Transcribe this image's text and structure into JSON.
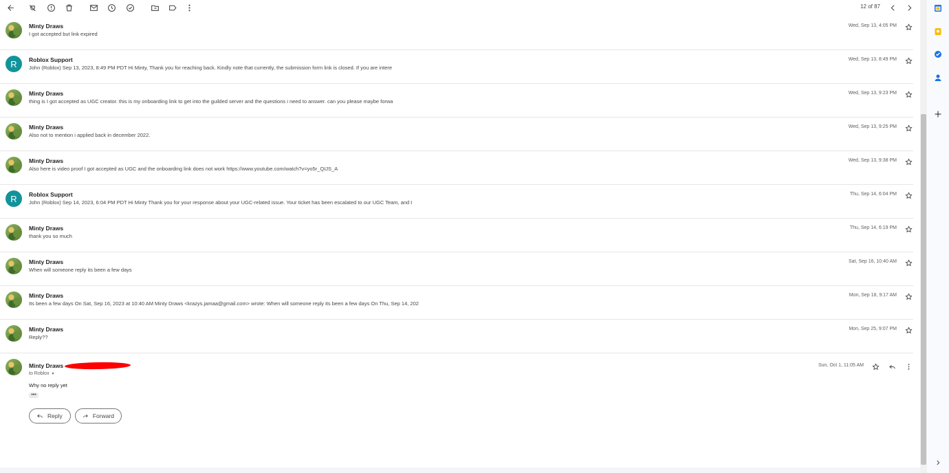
{
  "toolbar": {
    "pager": "12 of 87",
    "actions": [
      "back-icon",
      "spam-icon",
      "report-icon",
      "delete-icon",
      "mark-unread-icon",
      "snooze-icon",
      "add-task-icon",
      "move-to-icon",
      "label-icon",
      "more-vert-icon"
    ]
  },
  "messages": [
    {
      "sender": "Minty Draws",
      "snippet": "I got accepted but link expired",
      "date": "Wed, Sep 13, 4:05 PM",
      "avatar": "image"
    },
    {
      "sender": "Roblox Support",
      "snippet": "John (Roblox) Sep 13, 2023, 8:49 PM PDT Hi Minty, Thank you for reaching back. Kindly note that currently, the submission form link is closed. If you are intere",
      "date": "Wed, Sep 13, 8:49 PM",
      "avatar": "R"
    },
    {
      "sender": "Minty Draws",
      "snippet": "thing is I got accepted as UGC creator. this is my onboarding link to get into the guilded server and the questions i need to answer. can you please maybe forwa",
      "date": "Wed, Sep 13, 9:23 PM",
      "avatar": "image"
    },
    {
      "sender": "Minty Draws",
      "snippet": "Also not to mention i applied back in december 2022.",
      "date": "Wed, Sep 13, 9:25 PM",
      "avatar": "image"
    },
    {
      "sender": "Minty Draws",
      "snippet": "Also here is video proof I got accepted as UGC and the onboarding link does not work https://www.youtube.com/watch?v=yo5r_QIJS_A",
      "date": "Wed, Sep 13, 9:38 PM",
      "avatar": "image"
    },
    {
      "sender": "Roblox Support",
      "snippet": "John (Roblox) Sep 14, 2023, 6:04 PM PDT Hi Minty Thank you for your response about your UGC-related issue. Your ticket has been escalated to our UGC Team, and t",
      "date": "Thu, Sep 14, 6:04 PM",
      "avatar": "R"
    },
    {
      "sender": "Minty Draws",
      "snippet": "thank you so much",
      "date": "Thu, Sep 14, 6:19 PM",
      "avatar": "image"
    },
    {
      "sender": "Minty Draws",
      "snippet": "When will someone reply its been a few days",
      "date": "Sat, Sep 16, 10:40 AM",
      "avatar": "image"
    },
    {
      "sender": "Minty Draws",
      "snippet": "Its been a few days On Sat, Sep 16, 2023 at 10:40 AM Minty Draws <krazys.jamaa@gmail.com> wrote: When will someone reply its been a few days On Thu, Sep 14, 202",
      "date": "Mon, Sep 18, 9:17 AM",
      "avatar": "image"
    },
    {
      "sender": "Minty Draws",
      "snippet": "Reply??",
      "date": "Mon, Sep 25, 9:07 PM",
      "avatar": "image"
    }
  ],
  "expanded": {
    "sender": "Minty Draws",
    "to": "to Roblox",
    "date": "Sun, Oct 1, 11:05 AM",
    "body": "Why no reply yet",
    "ellipsis": "•••",
    "reply_label": "Reply",
    "forward_label": "Forward"
  },
  "side_panel": [
    "calendar-icon",
    "keep-icon",
    "tasks-icon",
    "contacts-icon",
    "add-icon",
    "expand-icon"
  ],
  "colors": {
    "roblox_avatar": "#12939a",
    "redaction": "#ff0000"
  }
}
